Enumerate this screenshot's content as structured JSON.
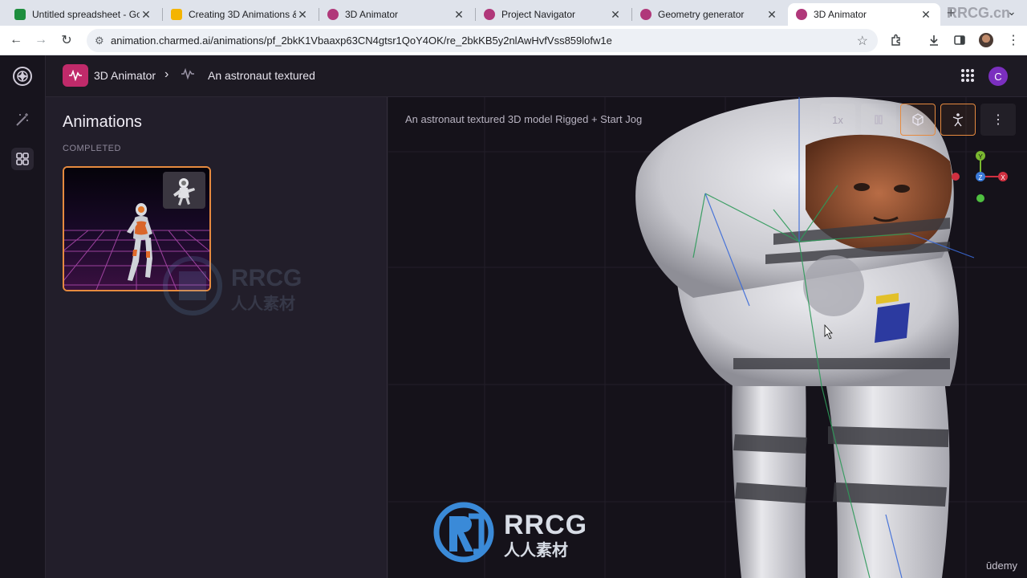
{
  "browser": {
    "tabs": [
      {
        "title": "Untitled spreadsheet - Go",
        "favicon_color": "#1e8e3e",
        "active": false
      },
      {
        "title": "Creating 3D Animations &",
        "favicon_color": "#f4b400",
        "active": false
      },
      {
        "title": "3D Animator",
        "favicon_color": "#b0387a",
        "active": false
      },
      {
        "title": "Project Navigator",
        "favicon_color": "#b0387a",
        "active": false
      },
      {
        "title": "Geometry generator",
        "favicon_color": "#b0387a",
        "active": false
      },
      {
        "title": "3D Animator",
        "favicon_color": "#b0387a",
        "active": true
      }
    ],
    "url": "animation.charmed.ai/animations/pf_2bkK1Vbaaxp63CN4gtsr1QoY4OK/re_2bkKB5y2nlAwHvfVss859lofw1e"
  },
  "header": {
    "app_name": "3D Animator",
    "breadcrumb": "An astronaut  textured"
  },
  "user": {
    "initial": "C",
    "color": "#7b2fbf"
  },
  "panel": {
    "title": "Animations",
    "section": "COMPLETED"
  },
  "viewport": {
    "title": "An astronaut textured 3D model Rigged + Start Jog",
    "speed_label": "1x",
    "axes": [
      "Y",
      "Z",
      "X"
    ]
  },
  "watermarks": {
    "top_right": "RRCG.cn",
    "logo_text": "RRCG",
    "logo_sub": "人人素材"
  },
  "footer": {
    "brand": "ūdemy"
  },
  "colors": {
    "accent": "#e68a3f",
    "brand": "#c02a6a"
  }
}
